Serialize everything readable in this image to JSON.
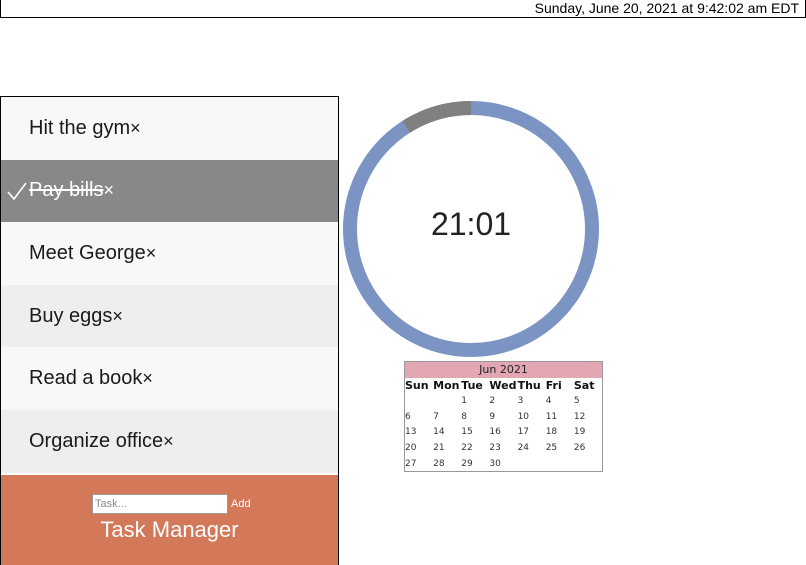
{
  "header": {
    "datetime": "Sunday, June 20, 2021 at 9:42:02 am EDT"
  },
  "tasks": [
    {
      "text": "Hit the gym",
      "done": false
    },
    {
      "text": "Pay bills",
      "done": true
    },
    {
      "text": "Meet George",
      "done": false
    },
    {
      "text": "Buy eggs",
      "done": false
    },
    {
      "text": "Read a book",
      "done": false
    },
    {
      "text": "Organize office",
      "done": false
    }
  ],
  "close_glyph": "×",
  "task_form": {
    "placeholder": "Task...",
    "value": "",
    "add_label": "Add"
  },
  "app_title": "Task Manager",
  "timer": {
    "display": "21:01",
    "elapsed_fraction": 0.09,
    "track_color": "#7b94c3",
    "elapsed_color": "#808080"
  },
  "calendar": {
    "month_label": "Jun 2021",
    "weekdays": [
      "Sun",
      "Mon",
      "Tue",
      "Wed",
      "Thu",
      "Fri",
      "Sat"
    ],
    "weeks": [
      [
        "",
        "",
        "1",
        "2",
        "3",
        "4",
        "5"
      ],
      [
        "6",
        "7",
        "8",
        "9",
        "10",
        "11",
        "12"
      ],
      [
        "13",
        "14",
        "15",
        "16",
        "17",
        "18",
        "19"
      ],
      [
        "20",
        "21",
        "22",
        "23",
        "24",
        "25",
        "26"
      ],
      [
        "27",
        "28",
        "29",
        "30",
        "",
        "",
        ""
      ]
    ],
    "header_color": "#e3a7b3"
  },
  "colors": {
    "footer": "#d4785a",
    "done_row": "#888888"
  },
  "icons": {
    "check": "check-icon",
    "close": "close-icon"
  }
}
